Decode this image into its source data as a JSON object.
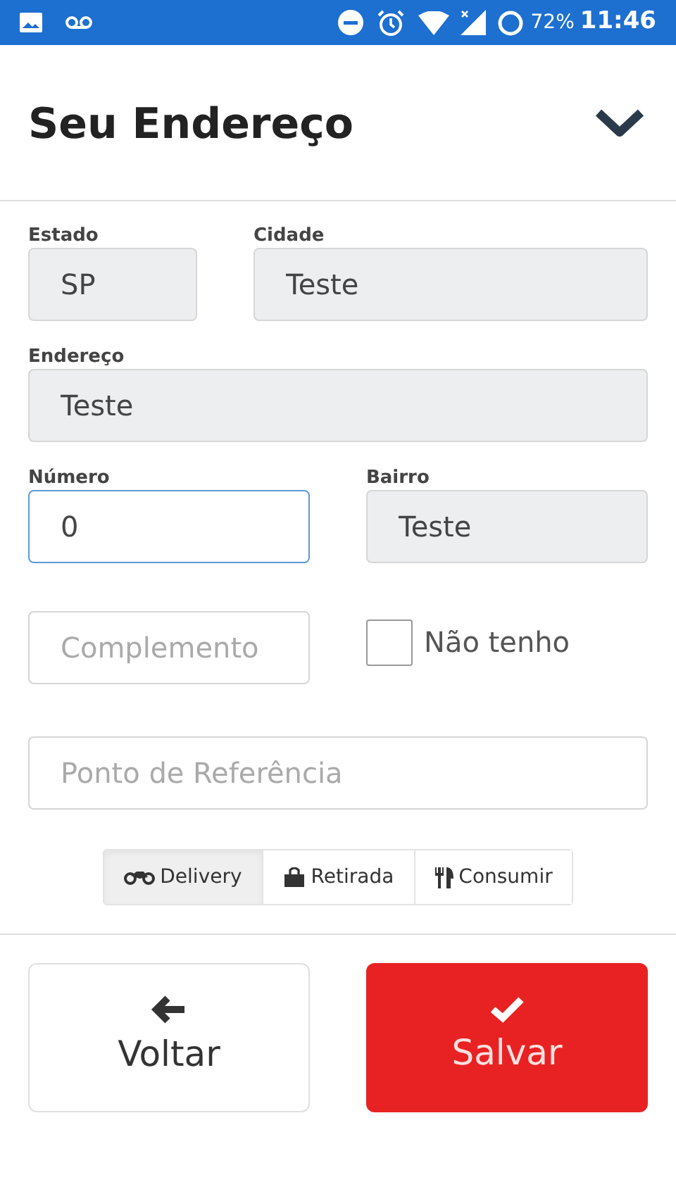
{
  "status_bar": {
    "battery": "72%",
    "time": "11:46"
  },
  "header": {
    "title": "Seu Endereço",
    "expanded": true
  },
  "rows": [
    [
      {
        "kind": "field",
        "label": "Estado",
        "value": "SP",
        "readonly": true,
        "focused": false
      },
      {
        "kind": "field",
        "label": "Cidade",
        "value": "Teste",
        "readonly": true,
        "focused": false
      }
    ],
    [
      {
        "kind": "field",
        "label": "Endereço",
        "value": "Teste",
        "readonly": true,
        "focused": false
      }
    ],
    [
      {
        "kind": "field",
        "label": "Número",
        "value": "0",
        "readonly": false,
        "focused": true
      },
      {
        "kind": "field",
        "label": "Bairro",
        "value": "Teste",
        "readonly": true,
        "focused": false
      }
    ],
    [
      {
        "kind": "field",
        "placeholder": "Complemento",
        "readonly": false,
        "focused": false
      },
      {
        "kind": "checkbox",
        "label": "Não tenho",
        "checked": false
      }
    ],
    [
      {
        "kind": "field",
        "placeholder": "Ponto de Referência",
        "readonly": false,
        "focused": false
      }
    ]
  ],
  "order_types": [
    {
      "label": "Delivery",
      "kind": "delivery",
      "selected": true
    },
    {
      "label": "Retirada",
      "kind": "pickup",
      "selected": false
    },
    {
      "label": "Consumir",
      "kind": "dine_in",
      "selected": false
    }
  ],
  "buttons": [
    {
      "kind": "back",
      "label": "Voltar"
    },
    {
      "kind": "save",
      "label": "Salvar"
    }
  ]
}
